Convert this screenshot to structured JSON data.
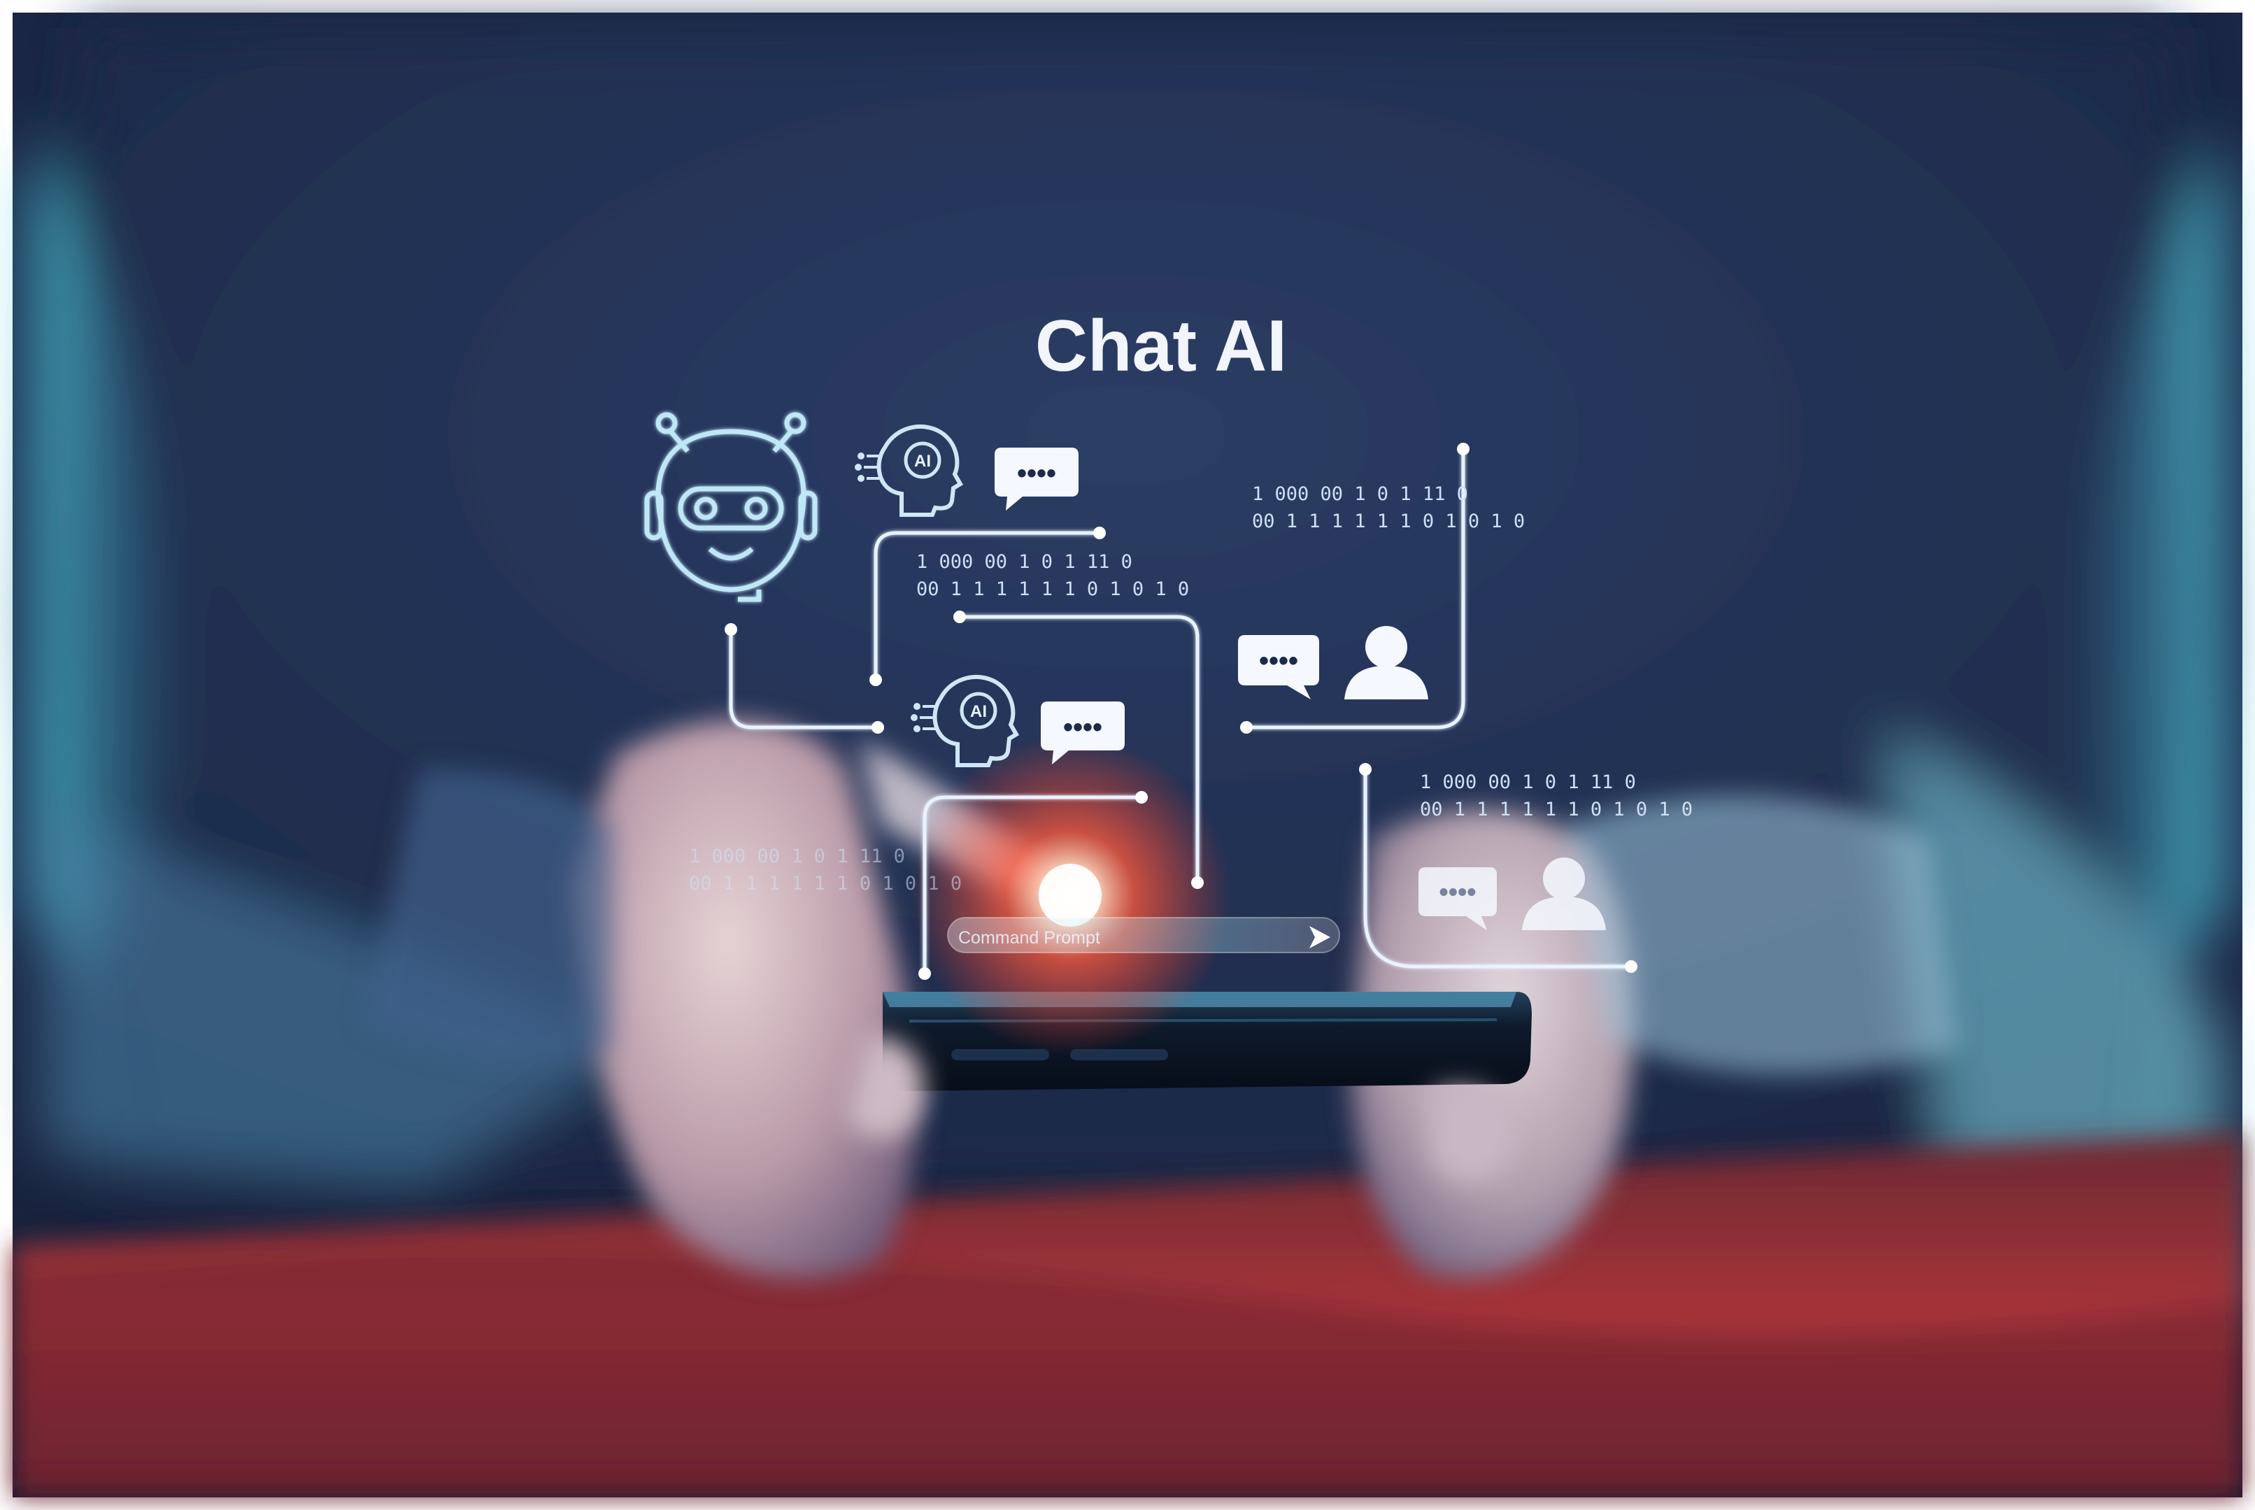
{
  "title": "Chat AI",
  "ai_badge": "AI",
  "command_prompt": "Command Prompt",
  "dots": "••••",
  "binary": {
    "top_left_line1": "1 000 00 1 0 1 11 0",
    "top_left_line2": "00 1 1 1 1 1 1 0 1 0 1 0",
    "top_right_line1": "1 000 00 1 0 1 11 0",
    "top_right_line2": "00 1 1 1 1 1 1 0 1 0 1 0",
    "bottom_right_line1": "1 000 00 1 0 1 11 0",
    "bottom_right_line2": "00 1 1 1 1 1 1 0 1 0 1 0",
    "bottom_left_line1": "1 000 00 1 0 1 11 0",
    "bottom_left_line2": "00 1 1 1 1 1 1 0 1 0 1 0"
  },
  "icons": {
    "robot": "robot-head-icon",
    "ai_head": "ai-head-icon",
    "chat": "chat-bubble-icon",
    "user": "user-icon",
    "send": "send-arrow-icon"
  },
  "colors": {
    "background": "#1d2b4a",
    "shirt": "#27365c",
    "glow": "#ff5a3c",
    "hologram": "#e9f3ff",
    "cyan": "#3fc0d8",
    "phone": "#0b1424"
  }
}
